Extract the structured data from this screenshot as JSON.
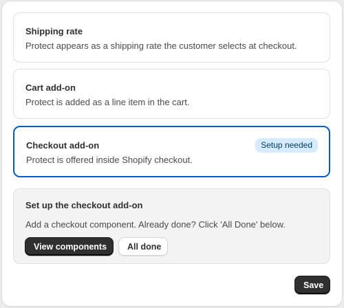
{
  "options": [
    {
      "title": "Shipping rate",
      "description": "Protect appears as a shipping rate the customer selects at checkout."
    },
    {
      "title": "Cart add-on",
      "description": "Protect is added as a line item in the cart."
    },
    {
      "title": "Checkout add-on",
      "description": "Protect is offered inside Shopify checkout.",
      "badge": "Setup needed",
      "selected": true
    }
  ],
  "setup": {
    "title": "Set up the checkout add-on",
    "description": "Add a checkout component. Already done? Click 'All Done' below.",
    "view_components_label": "View components",
    "all_done_label": "All done"
  },
  "footer": {
    "save_label": "Save"
  },
  "colors": {
    "selected_border": "#005bd3",
    "badge_bg": "#d5ebff",
    "primary_button": "#303030"
  }
}
